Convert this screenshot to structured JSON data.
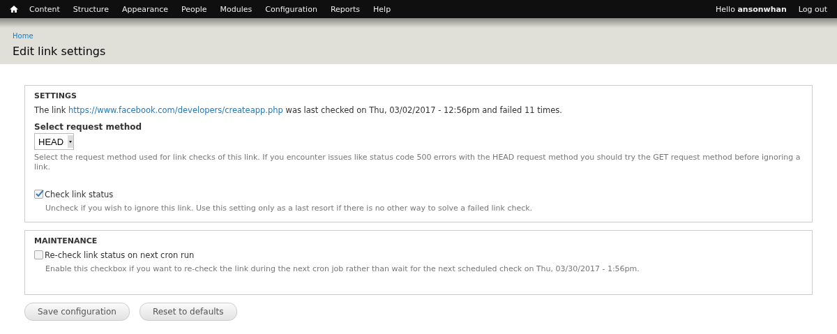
{
  "toolbar": {
    "menu": [
      "Content",
      "Structure",
      "Appearance",
      "People",
      "Modules",
      "Configuration",
      "Reports",
      "Help"
    ],
    "greeting": "Hello **ansonwhan**",
    "logout": "Log out"
  },
  "breadcrumb": [
    "Home"
  ],
  "page_title": "Edit link settings",
  "settings": {
    "legend": "SETTINGS",
    "status": {
      "before": "The link ",
      "link": "https://www.facebook.com/developers/createapp.php",
      "after": " was last checked on Thu, 03/02/2017 - 12:56pm and failed 11 times."
    },
    "method_label": "Select request method",
    "method_value": "HEAD",
    "method_help": "Select the request method used for link checks of this link. If you encounter issues like status code 500 errors with the HEAD request method you should try the GET request method before ignoring a link.",
    "check": {
      "label": "Check link status",
      "checked": true,
      "help": "Uncheck if you wish to ignore this link. Use this setting only as a last resort if there is no other way to solve a failed link check."
    }
  },
  "maintenance": {
    "legend": "MAINTENANCE",
    "check": {
      "label": "Re-check link status on next cron run",
      "checked": false,
      "help": "Enable this checkbox if you want to re-check the link during the next cron job rather than wait for the next scheduled check on Thu, 03/30/2017 - 1:56pm."
    }
  },
  "buttons": [
    "Save configuration",
    "Reset to defaults"
  ]
}
